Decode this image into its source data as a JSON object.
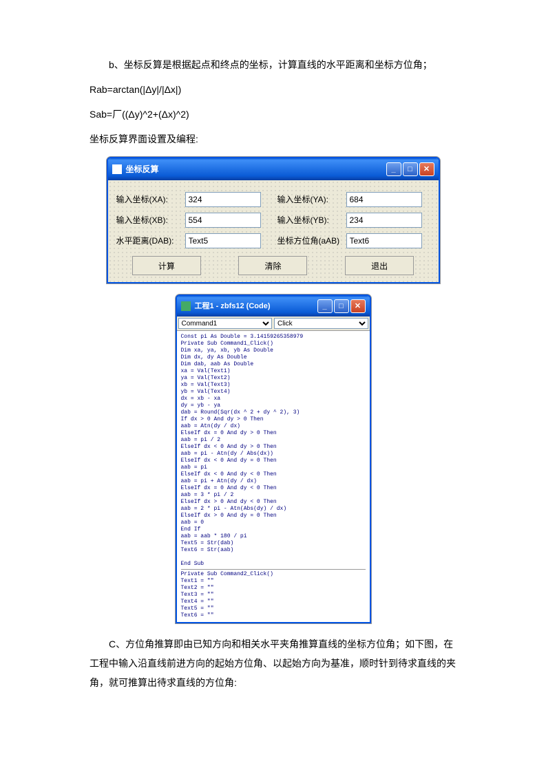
{
  "paragraphs": {
    "p1": "b、坐标反算是根据起点和终点的坐标，计算直线的水平距离和坐标方位角；",
    "p2": "Rab=arctan(|Δy|/|Δx|)",
    "p3": "Sab=厂((Δy)^2+(Δx)^2)",
    "p4": "坐标反算界面设置及编程:",
    "p5": "C、方位角推算即由已知方向和相关水平夹角推算直线的坐标方位角；如下图，在工程中输入沿直线前进方向的起始方位角、以起始方向为基准，顺时针到待求直线的夹角，就可推算出待求直线的方位角:"
  },
  "form": {
    "title": "坐标反算",
    "xa_label": "输入坐标(XA):",
    "xa_val": "324",
    "ya_label": "输入坐标(YA):",
    "ya_val": "684",
    "xb_label": "输入坐标(XB):",
    "xb_val": "554",
    "yb_label": "输入坐标(YB):",
    "yb_val": "234",
    "dab_label": "水平距离(DAB):",
    "dab_val": "Text5",
    "aab_label": "坐标方位角(aAB)",
    "aab_val": "Text6",
    "btn_calc": "计算",
    "btn_clear": "清除",
    "btn_exit": "退出"
  },
  "code": {
    "title": "工程1 - zbfs12 (Code)",
    "combo1": "Command1",
    "combo2": "Click",
    "body": "Const pi As Double = 3.14159265358979\nPrivate Sub Command1_Click()\nDim xa, ya, xb, yb As Double\nDim dx, dy As Double\nDim dab, aab As Double\nxa = Val(Text1)\nya = Val(Text2)\nxb = Val(Text3)\nyb = Val(Text4)\ndx = xb - xa\ndy = yb - ya\ndab = Round(Sqr(dx ^ 2 + dy ^ 2), 3)\nIf dx > 0 And dy > 0 Then\naab = Atn(dy / dx)\nElseIf dx = 0 And dy > 0 Then\naab = pi / 2\nElseIf dx < 0 And dy > 0 Then\naab = pi - Atn(dy / Abs(dx))\nElseIf dx < 0 And dy = 0 Then\naab = pi\nElseIf dx < 0 And dy < 0 Then\naab = pi + Atn(dy / dx)\nElseIf dx = 0 And dy < 0 Then\naab = 3 * pi / 2\nElseIf dx > 0 And dy < 0 Then\naab = 2 * pi - Atn(Abs(dy) / dx)\nElseIf dx > 0 And dy = 0 Then\naab = 0\nEnd If\naab = aab * 180 / pi\nText5 = Str(dab)\nText6 = Str(aab)\n\nEnd Sub",
    "body2": "Private Sub Command2_Click()\nText1 = \"\"\nText2 = \"\"\nText3 = \"\"\nText4 = \"\"\nText5 = \"\"\nText6 = \"\""
  }
}
